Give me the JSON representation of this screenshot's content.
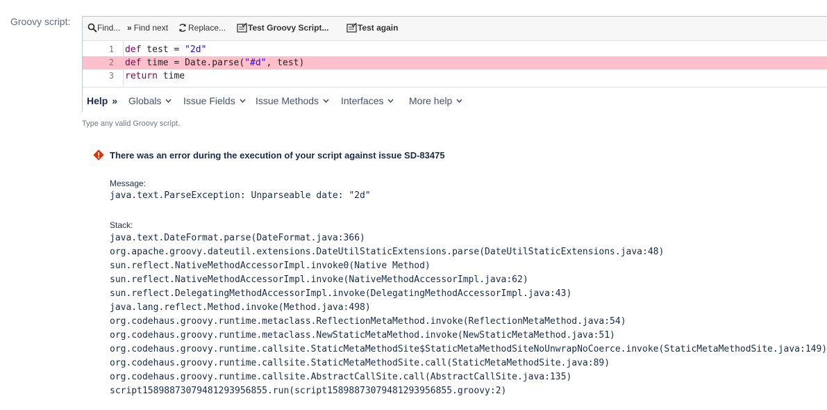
{
  "field": {
    "label": "Groovy script:"
  },
  "toolbar": {
    "find": "Find...",
    "find_next": "Find next",
    "replace": "Replace...",
    "test_script": "Test Groovy Script...",
    "test_again": "Test again"
  },
  "code": {
    "lines": [
      {
        "num": "1",
        "kw": "def",
        "text": " test = ",
        "str": "\"2d\"",
        "tail": ""
      },
      {
        "num": "2",
        "kw": "def",
        "text": " time = Date.parse(",
        "str": "\"#d\"",
        "tail": ", test)"
      },
      {
        "num": "3",
        "kw": "return",
        "text": " time",
        "str": "",
        "tail": ""
      }
    ],
    "error_line_color": "#ffc0cb"
  },
  "helpbar": {
    "help": "Help",
    "items": [
      "Globals",
      "Issue Fields",
      "Issue Methods",
      "Interfaces",
      "More help"
    ]
  },
  "hint": "Type any valid Groovy script.",
  "error": {
    "title": "There was an error during the execution of your script against issue SD-83475",
    "message_label": "Message:",
    "message": "java.text.ParseException: Unparseable date: \"2d\"",
    "stack_label": "Stack:",
    "stack": [
      "java.text.DateFormat.parse(DateFormat.java:366)",
      "org.apache.groovy.dateutil.extensions.DateUtilStaticExtensions.parse(DateUtilStaticExtensions.java:48)",
      "sun.reflect.NativeMethodAccessorImpl.invoke0(Native Method)",
      "sun.reflect.NativeMethodAccessorImpl.invoke(NativeMethodAccessorImpl.java:62)",
      "sun.reflect.DelegatingMethodAccessorImpl.invoke(DelegatingMethodAccessorImpl.java:43)",
      "java.lang.reflect.Method.invoke(Method.java:498)",
      "org.codehaus.groovy.runtime.metaclass.ReflectionMetaMethod.invoke(ReflectionMetaMethod.java:54)",
      "org.codehaus.groovy.runtime.metaclass.NewStaticMetaMethod.invoke(NewStaticMetaMethod.java:51)",
      "org.codehaus.groovy.runtime.callsite.StaticMetaMethodSite$StaticMetaMethodSiteNoUnwrapNoCoerce.invoke(StaticMetaMethodSite.java:149)",
      "org.codehaus.groovy.runtime.callsite.StaticMetaMethodSite.call(StaticMetaMethodSite.java:89)",
      "org.codehaus.groovy.runtime.callsite.AbstractCallSite.call(AbstractCallSite.java:135)",
      "script1589887307948129395685​5.run(script15898873079481293956855.groovy:2)"
    ],
    "icon_color": "#de350b"
  }
}
